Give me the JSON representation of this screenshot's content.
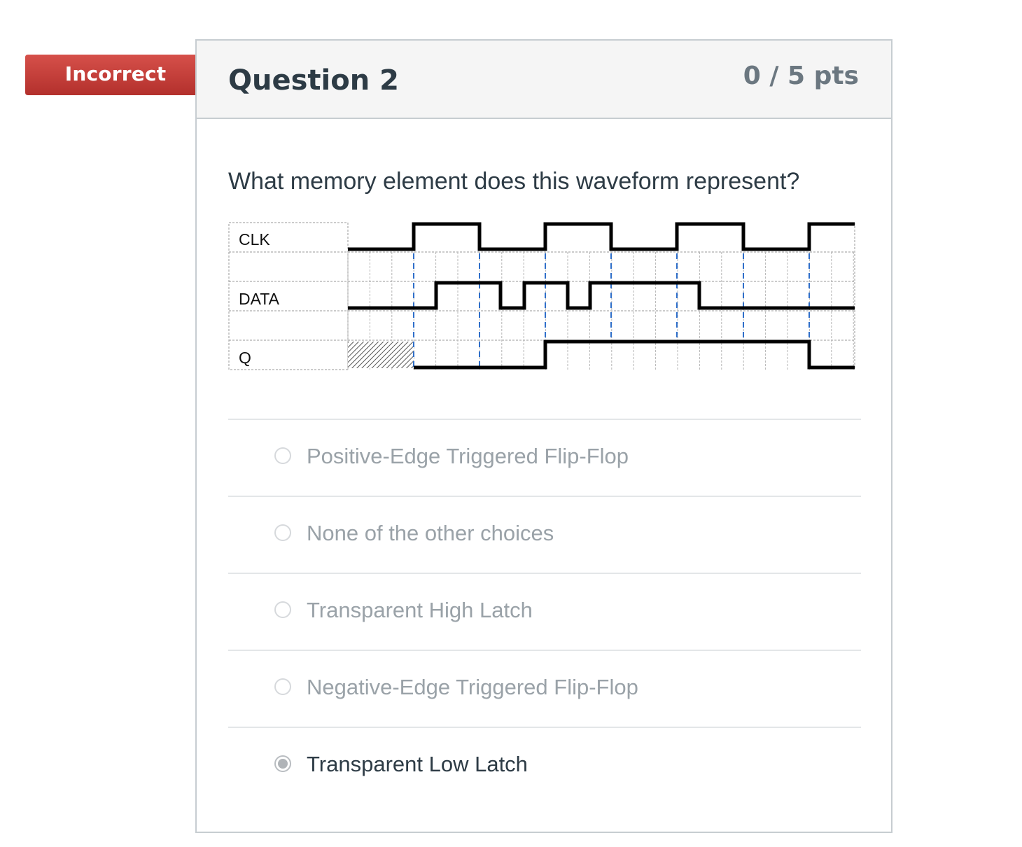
{
  "status_badge": {
    "label": "Incorrect",
    "color": "#c63a35"
  },
  "question": {
    "title": "Question 2",
    "points": "0 / 5 pts",
    "text": "What memory element does this waveform represent?"
  },
  "waveform": {
    "signals": [
      {
        "name": "CLK"
      },
      {
        "name": "DATA"
      },
      {
        "name": "Q"
      }
    ],
    "edge_marker_color": "#2f6fca"
  },
  "answers": [
    {
      "label": "Positive-Edge Triggered Flip-Flop",
      "selected": false
    },
    {
      "label": "None of the other choices",
      "selected": false
    },
    {
      "label": "Transparent High Latch",
      "selected": false
    },
    {
      "label": "Negative-Edge Triggered Flip-Flop",
      "selected": false
    },
    {
      "label": "Transparent Low Latch",
      "selected": true
    }
  ]
}
